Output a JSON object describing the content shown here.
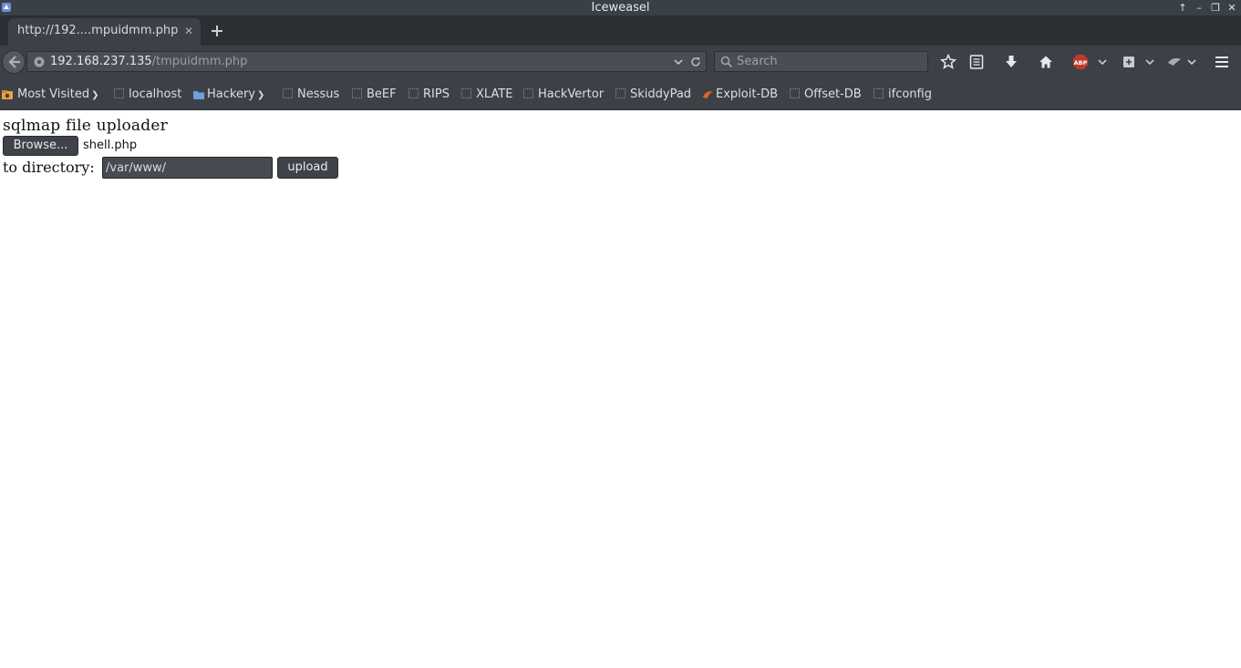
{
  "window": {
    "title": "Iceweasel"
  },
  "tab": {
    "label": "http://192....mpuidmm.php"
  },
  "navbar": {
    "url_host": "192.168.237.135",
    "url_path": "/tmpuidmm.php",
    "search_placeholder": "Search"
  },
  "bookmarks": [
    {
      "label": "Most Visited",
      "icon": "most-visited-icon"
    },
    {
      "label": "localhost",
      "icon": "page-icon"
    },
    {
      "label": "Hackery",
      "icon": "folder-icon"
    },
    {
      "label": "Nessus",
      "icon": "page-icon"
    },
    {
      "label": "BeEF",
      "icon": "page-icon"
    },
    {
      "label": "RIPS",
      "icon": "page-icon"
    },
    {
      "label": "XLATE",
      "icon": "page-icon"
    },
    {
      "label": "HackVertor",
      "icon": "page-icon"
    },
    {
      "label": "SkiddyPad",
      "icon": "page-icon"
    },
    {
      "label": "Exploit-DB",
      "icon": "exploit-db-icon"
    },
    {
      "label": "Offset-DB",
      "icon": "page-icon"
    },
    {
      "label": "ifconfig",
      "icon": "page-icon"
    }
  ],
  "page": {
    "title": "sqlmap file uploader",
    "browse_label": "Browse...",
    "selected_file": "shell.php",
    "dir_label": "to directory:",
    "dir_value": "/var/www/",
    "upload_label": "upload"
  },
  "colors": {
    "chrome_dark": "#3d4147",
    "abp_red": "#c0392b",
    "exploit_orange": "#e8641c"
  }
}
